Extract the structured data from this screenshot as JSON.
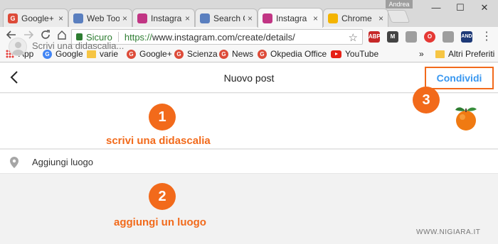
{
  "browser": {
    "user_name": "Andrea",
    "tabs": [
      {
        "label": "Google+",
        "icon": "google-plus-icon",
        "color": "#dd4b39",
        "active": false
      },
      {
        "label": "Web Too",
        "icon": "document-icon",
        "color": "#5a7fbf",
        "active": false
      },
      {
        "label": "Instagra",
        "icon": "instagram-icon",
        "color": "#c13584",
        "active": false
      },
      {
        "label": "Search C",
        "icon": "document-icon",
        "color": "#5a7fbf",
        "active": false
      },
      {
        "label": "Instagra",
        "icon": "instagram-icon",
        "color": "#c13584",
        "active": true
      },
      {
        "label": "Chrome",
        "icon": "chrome-icon",
        "color": "#f4b400",
        "active": false
      }
    ],
    "close_glyph": "×",
    "window_controls": {
      "minimize": "—",
      "maximize": "☐",
      "close": "✕"
    },
    "address": {
      "secure_label": "Sicuro",
      "url_scheme": "https://",
      "url_rest": "www.instagram.com/create/details/"
    },
    "extensions": [
      {
        "name": "adblock-plus-icon",
        "label": "ABP",
        "color": "#c62828"
      },
      {
        "name": "gmail-m-icon",
        "label": "M",
        "color": "#444444"
      },
      {
        "name": "camera-icon",
        "label": "",
        "color": "#9e9e9e"
      },
      {
        "name": "opera-icon",
        "label": "O",
        "color": "#e53935"
      },
      {
        "name": "library-icon",
        "label": "",
        "color": "#9e9e9e"
      },
      {
        "name": "and-icon",
        "label": "AND",
        "color": "#1e3a78"
      }
    ],
    "menu_glyph": "⋮",
    "bookmarks": [
      {
        "label": "App",
        "type": "apps"
      },
      {
        "label": "Google",
        "type": "google"
      },
      {
        "label": "varie",
        "type": "folder"
      },
      {
        "label": "Google+",
        "type": "gplus"
      },
      {
        "label": "Scienza",
        "type": "gplus"
      },
      {
        "label": "News",
        "type": "gplus"
      },
      {
        "label": "Okpedia Office",
        "type": "gplus"
      },
      {
        "label": "YouTube",
        "type": "youtube"
      }
    ],
    "bookmarks_overflow": "»",
    "other_bookmarks": "Altri Preferiti"
  },
  "page": {
    "title": "Nuovo post",
    "share_label": "Condividi",
    "caption_placeholder": "Scrivi una didascalia...",
    "location_label": "Aggiungi luogo"
  },
  "annotations": {
    "step1_number": "1",
    "step1_text": "scrivi una didascalia",
    "step2_number": "2",
    "step2_text": "aggiungi un luogo",
    "step3_number": "3",
    "accent_color": "#f26a1b"
  },
  "watermark": "WWW.NIGIARA.IT"
}
